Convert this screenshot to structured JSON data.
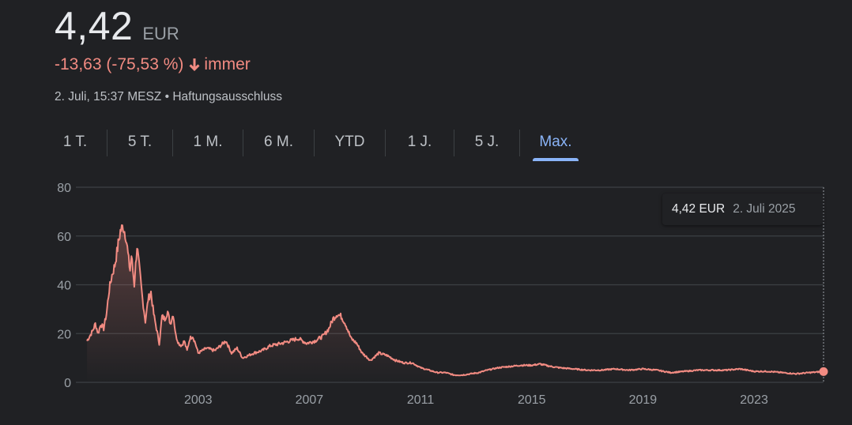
{
  "header": {
    "price": "4,42",
    "currency": "EUR",
    "change": "-13,63 (-75,53 %)",
    "period": "immer",
    "timestamp": "2. Juli, 15:37 MESZ",
    "separator": "•",
    "disclaimer": "Haftungsausschluss"
  },
  "tabs": [
    {
      "label": "1 T."
    },
    {
      "label": "5 T."
    },
    {
      "label": "1 M."
    },
    {
      "label": "6 M."
    },
    {
      "label": "YTD"
    },
    {
      "label": "1 J."
    },
    {
      "label": "5 J."
    },
    {
      "label": "Max."
    }
  ],
  "active_tab": "Max.",
  "tooltip": {
    "value": "4,42 EUR",
    "date": "2. Juli 2025"
  },
  "colors": {
    "background": "#202124",
    "line": "#f28b82",
    "negative": "#f28b82",
    "active_tab": "#8ab4f8",
    "grid": "#3c4043"
  },
  "chart_data": {
    "type": "area",
    "ylim": [
      0,
      80
    ],
    "yticks": [
      0,
      20,
      40,
      60,
      80
    ],
    "xticks": [
      "2003",
      "2007",
      "2011",
      "2015",
      "2019",
      "2023"
    ],
    "xlim": [
      1998.6,
      2025.5
    ],
    "grid": true,
    "series": [
      {
        "x": [
          1999.0,
          1999.1,
          1999.2,
          1999.3,
          1999.4,
          1999.5,
          1999.6,
          1999.7,
          1999.8,
          1999.9,
          2000.0,
          2000.1,
          2000.2,
          2000.3,
          2000.4,
          2000.5,
          2000.55,
          2000.6,
          2000.7,
          2000.8,
          2000.9,
          2001.0,
          2001.1,
          2001.2,
          2001.3,
          2001.4,
          2001.5,
          2001.6,
          2001.7,
          2001.8,
          2001.9,
          2002.0,
          2002.1,
          2002.2,
          2002.3,
          2002.4,
          2002.5,
          2002.6,
          2002.7,
          2002.8,
          2002.9,
          2003.0,
          2003.3,
          2003.6,
          2004.0,
          2004.2,
          2004.4,
          2004.6,
          2005.0,
          2005.3,
          2005.6,
          2006.0,
          2006.3,
          2006.6,
          2006.9,
          2007.2,
          2007.5,
          2007.7,
          2007.85,
          2008.0,
          2008.15,
          2008.3,
          2008.5,
          2008.7,
          2008.9,
          2009.2,
          2009.5,
          2009.8,
          2010.1,
          2010.4,
          2010.7,
          2011.0,
          2011.3,
          2011.6,
          2011.9,
          2012.2,
          2012.5,
          2012.8,
          2013.1,
          2013.4,
          2013.8,
          2014.2,
          2014.6,
          2015.0,
          2015.3,
          2015.7,
          2016.0,
          2016.5,
          2017.0,
          2017.5,
          2018.0,
          2018.5,
          2019.0,
          2019.5,
          2020.0,
          2020.5,
          2021.0,
          2021.5,
          2022.0,
          2022.5,
          2023.0,
          2023.5,
          2024.0,
          2024.5,
          2025.0,
          2025.5
        ],
        "y": [
          17,
          19,
          21,
          24,
          20,
          24,
          22,
          28,
          38,
          44,
          48,
          55,
          62,
          64,
          60,
          50,
          46,
          52,
          40,
          56,
          45,
          34,
          25,
          34,
          37,
          28,
          22,
          16,
          27,
          26,
          29,
          24,
          28,
          19,
          16,
          15,
          17,
          13,
          18,
          19,
          16,
          12,
          14,
          13,
          17,
          12,
          14,
          10,
          12,
          13,
          15,
          16,
          17,
          18,
          16,
          17,
          19,
          22,
          26,
          28,
          27,
          24,
          18,
          16,
          12,
          9,
          12,
          11,
          9,
          8,
          8,
          6,
          5,
          4,
          4,
          3,
          3,
          3.5,
          4,
          5,
          6,
          6.5,
          7,
          7,
          7.5,
          6.5,
          6,
          5.5,
          5,
          5,
          5.5,
          5,
          5.5,
          5,
          4,
          4.5,
          5,
          5,
          5,
          5.5,
          4.5,
          4.5,
          4,
          3.5,
          4,
          4.42
        ]
      }
    ]
  }
}
